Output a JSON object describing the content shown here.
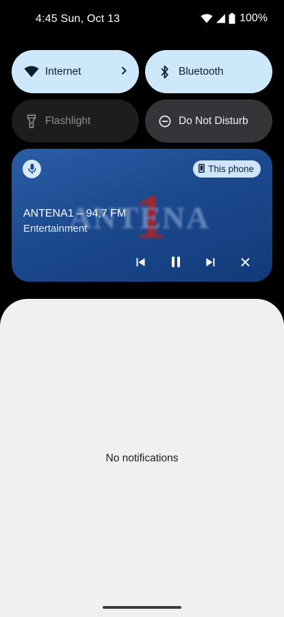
{
  "status_bar": {
    "time_date": "4:45 Sun, Oct 13",
    "battery_percent": "100%",
    "icons": [
      "wifi-icon",
      "cell-signal-icon",
      "battery-icon"
    ]
  },
  "quick_settings": {
    "tiles": [
      {
        "label": "Internet",
        "icon": "wifi-icon",
        "state": "on",
        "has_chevron": true
      },
      {
        "label": "Bluetooth",
        "icon": "bluetooth-icon",
        "state": "on"
      },
      {
        "label": "Flashlight",
        "icon": "flashlight-icon",
        "state": "off"
      },
      {
        "label": "Do Not Disturb",
        "icon": "dnd-icon",
        "state": "off"
      }
    ]
  },
  "media": {
    "output_label": "This phone",
    "title": "ANTENA1 – 94,7 FM",
    "subtitle": "Entertainment",
    "artwork_text": "ANTENA",
    "artwork_numeral": "1",
    "controls": [
      "previous-icon",
      "pause-icon",
      "next-icon",
      "close-icon"
    ],
    "colors": {
      "card": "#1c4a8f",
      "chip": "#cfe5fb",
      "logo_red": "#b42222"
    }
  },
  "notifications": {
    "empty_text": "No notifications"
  },
  "colors": {
    "tile_on": "#cde8fb",
    "tile_off": "#1d1d1f",
    "sheet": "#f0f0f2"
  }
}
